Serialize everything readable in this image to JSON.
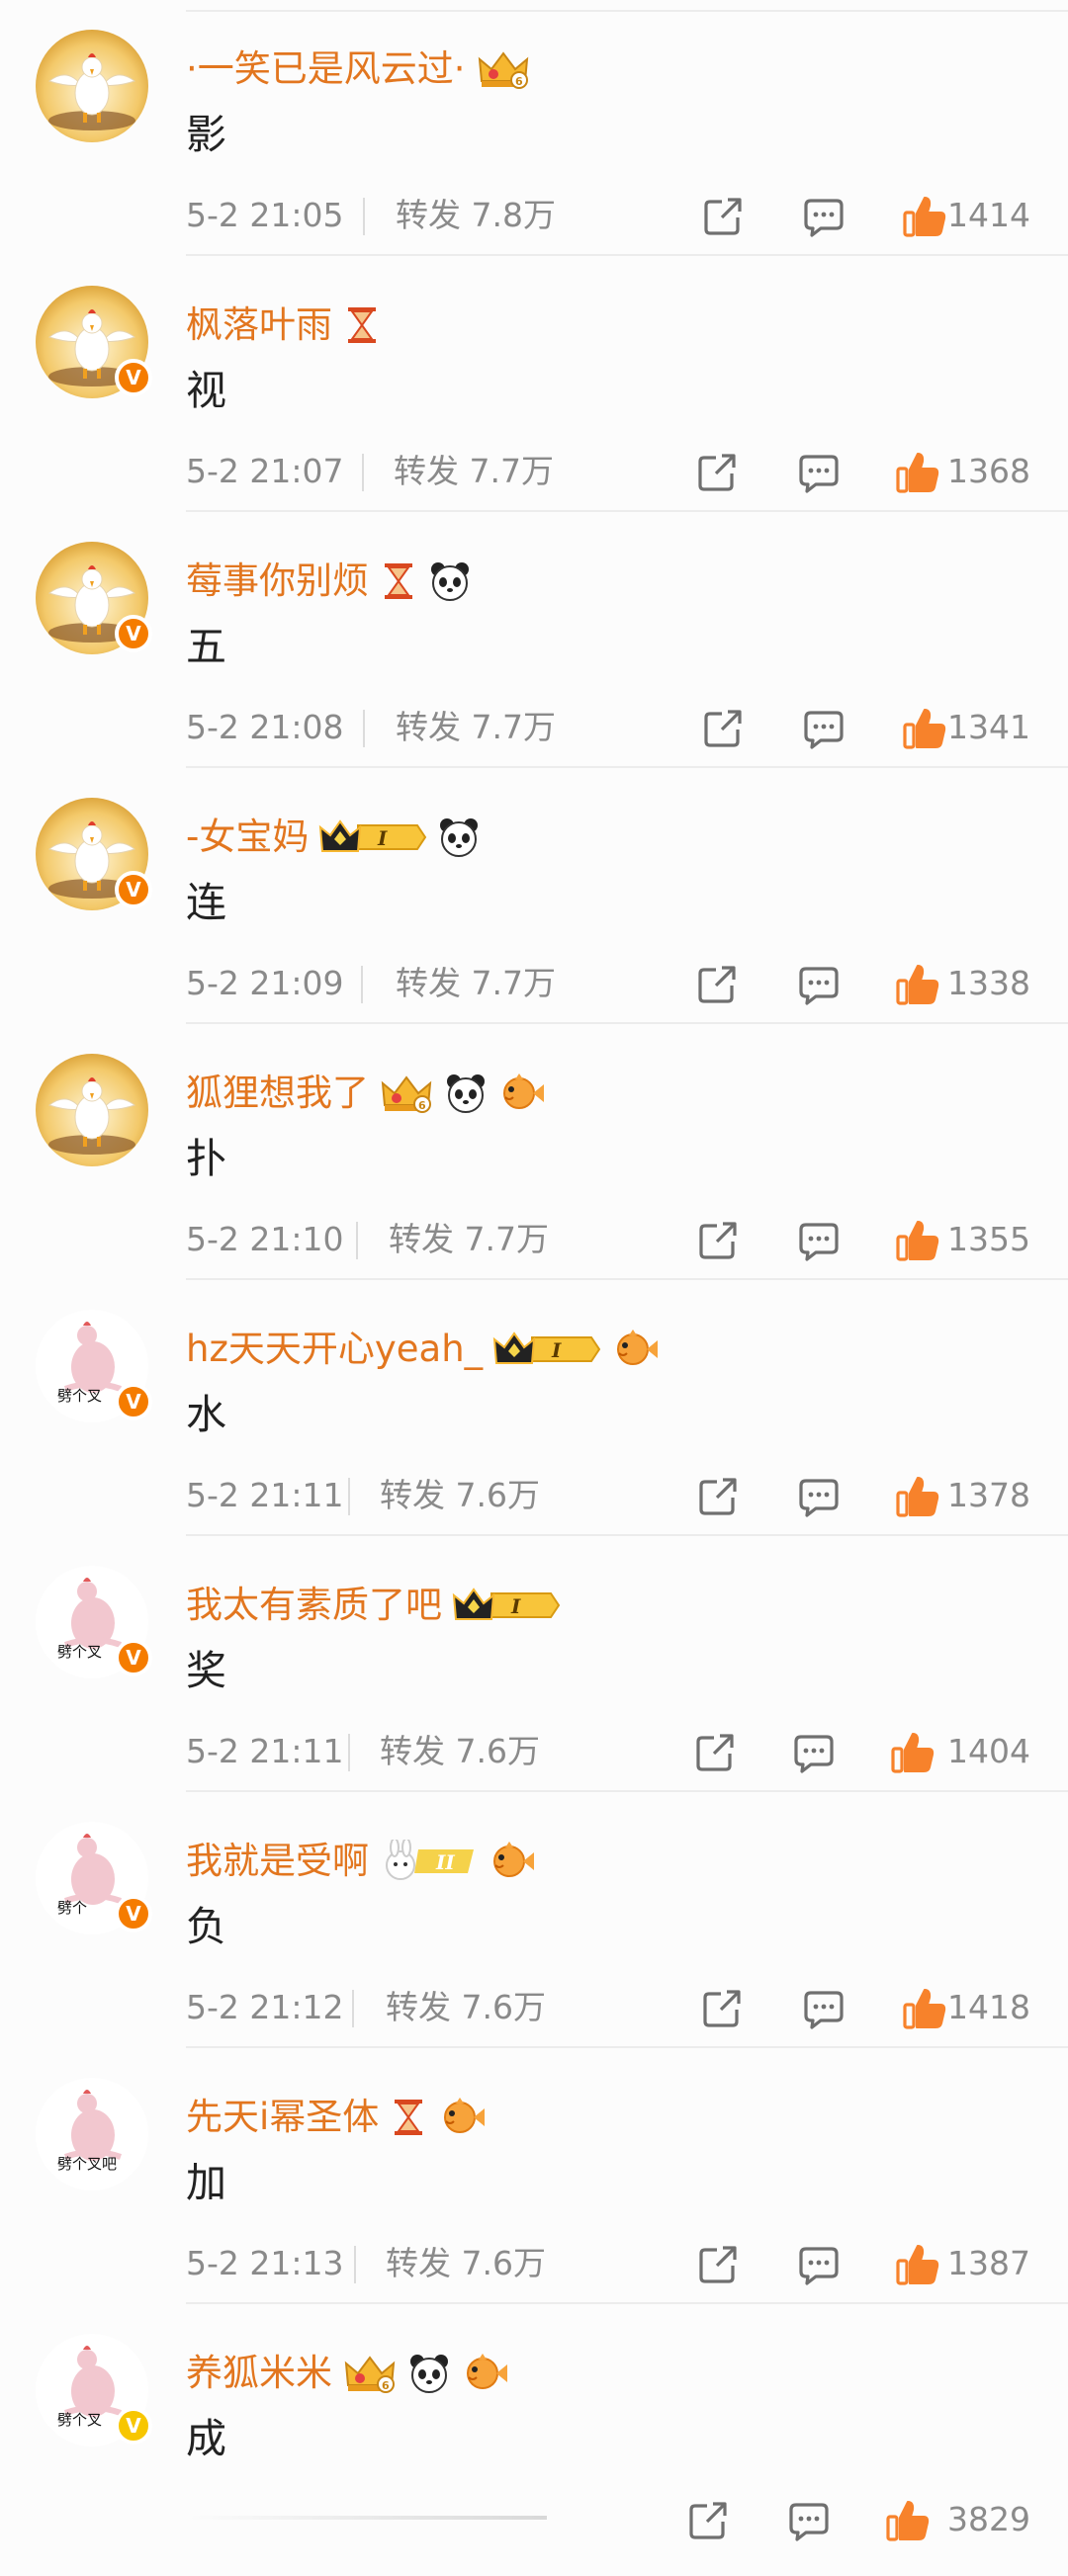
{
  "comments": [
    {
      "username": "·一笑已是风云过·",
      "text": "影",
      "time": "5-2 21:05",
      "repost_label": "转发 7.8万",
      "likes": "1414",
      "avatar": "chicken",
      "verified": null,
      "badges": [
        "crown-6"
      ]
    },
    {
      "username": "枫落叶雨",
      "text": "视",
      "time": "5-2 21:07",
      "repost_label": "转发 7.7万",
      "likes": "1368",
      "avatar": "chicken",
      "verified": "orange",
      "badges": [
        "hourglass"
      ]
    },
    {
      "username": "莓事你别烦",
      "text": "五",
      "time": "5-2 21:08",
      "repost_label": "转发 7.7万",
      "likes": "1341",
      "avatar": "chicken",
      "verified": "orange",
      "badges": [
        "hourglass",
        "panda"
      ]
    },
    {
      "username": "-女宝妈",
      "text": "连",
      "time": "5-2 21:09",
      "repost_label": "转发 7.7万",
      "likes": "1338",
      "avatar": "chicken",
      "verified": "orange",
      "badges": [
        "vip-1",
        "panda"
      ]
    },
    {
      "username": "狐狸想我了",
      "text": "扑",
      "time": "5-2 21:10",
      "repost_label": "转发 7.7万",
      "likes": "1355",
      "avatar": "chicken",
      "verified": null,
      "badges": [
        "crown-6",
        "panda",
        "fish"
      ]
    },
    {
      "username": "hz天天开心yeah_",
      "text": "水",
      "time": "5-2 21:11",
      "repost_label": "转发 7.6万",
      "likes": "1378",
      "avatar": "pink-chicken",
      "avatar_caption": "劈个叉",
      "verified": "orange",
      "badges": [
        "vip-1",
        "fish"
      ]
    },
    {
      "username": "我太有素质了吧",
      "text": "奖",
      "time": "5-2 21:11",
      "repost_label": "转发 7.6万",
      "likes": "1404",
      "avatar": "pink-chicken",
      "avatar_caption": "劈个叉",
      "verified": "orange",
      "badges": [
        "vip-1"
      ]
    },
    {
      "username": "我就是受啊",
      "text": "负",
      "time": "5-2 21:12",
      "repost_label": "转发 7.6万",
      "likes": "1418",
      "avatar": "pink-chicken",
      "avatar_caption": "劈个",
      "verified": "orange",
      "badges": [
        "bunny-2",
        "fish"
      ]
    },
    {
      "username": "先天i幂圣体",
      "text": "加",
      "time": "5-2 21:13",
      "repost_label": "转发 7.6万",
      "likes": "1387",
      "avatar": "pink-chicken",
      "avatar_caption": "劈个叉吧",
      "verified": null,
      "badges": [
        "hourglass",
        "fish"
      ]
    },
    {
      "username": "养狐米米",
      "text": "成",
      "time": "",
      "repost_label": "",
      "likes": "3829",
      "avatar": "pink-chicken",
      "avatar_caption": "劈个叉",
      "verified": "gold",
      "badges": [
        "crown-6",
        "panda",
        "fish"
      ]
    }
  ],
  "colors": {
    "username": "#e2761f",
    "meta_text": "#8a8a8a",
    "like_icon": "#f7822b",
    "verified_orange": "#f57c00",
    "verified_gold": "#f7c600"
  },
  "icons": {
    "verified_badge": "V",
    "share": "share-icon",
    "comment": "comment-icon",
    "like": "thumbs-up-icon"
  }
}
